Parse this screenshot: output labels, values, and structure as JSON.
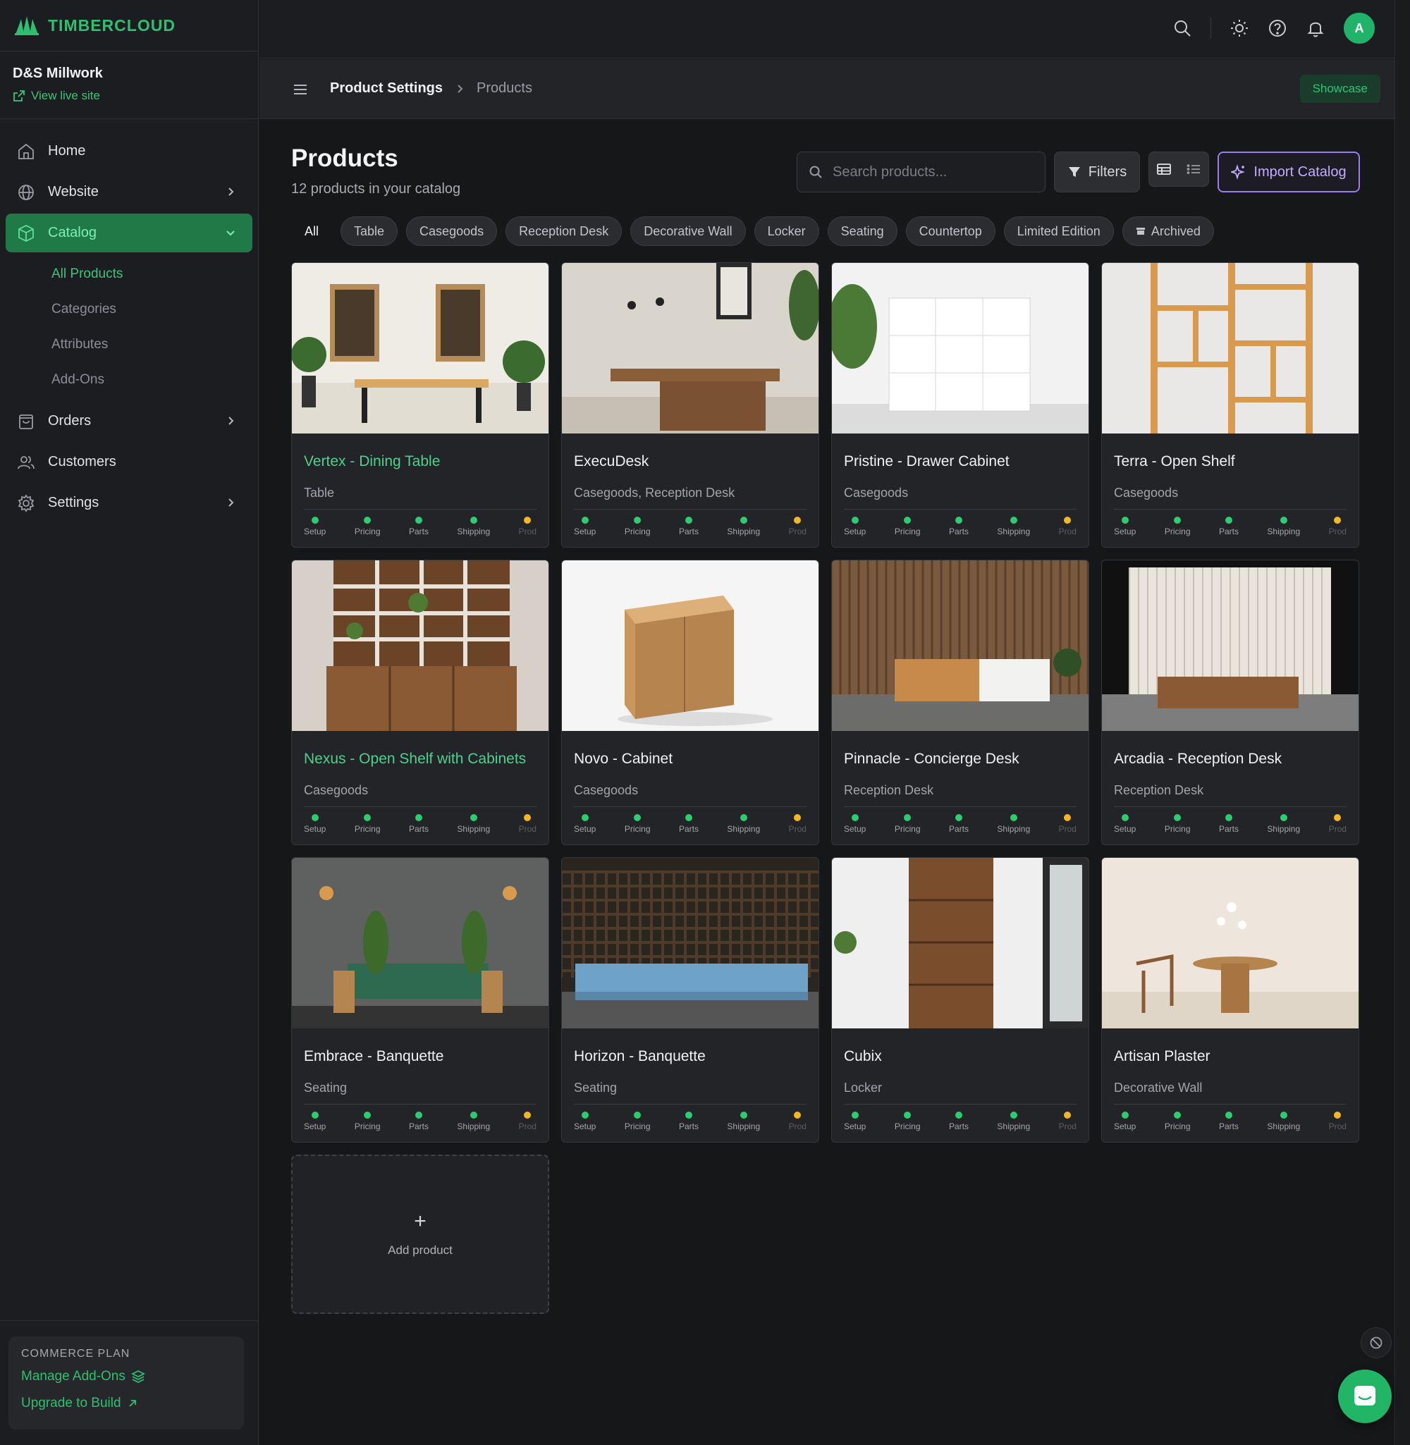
{
  "brand": {
    "name": "TIMBERCLOUD",
    "color": "#2fbf71"
  },
  "org": {
    "name": "D&S Millwork",
    "view_live_site": "View live site"
  },
  "nav": {
    "home": "Home",
    "website": "Website",
    "catalog": "Catalog",
    "catalog_sub": [
      "All Products",
      "Categories",
      "Attributes",
      "Add-Ons"
    ],
    "orders": "Orders",
    "customers": "Customers",
    "settings": "Settings"
  },
  "plan": {
    "title": "COMMERCE PLAN",
    "manage": "Manage Add-Ons",
    "upgrade": "Upgrade to Build"
  },
  "topbar": {
    "avatar_initial": "A"
  },
  "breadcrumb": {
    "parent": "Product Settings",
    "current": "Products",
    "showcase": "Showcase"
  },
  "header": {
    "title": "Products",
    "subtitle": "12 products in your catalog",
    "search_placeholder": "Search products...",
    "filters": "Filters",
    "import": "Import Catalog"
  },
  "chips": [
    "All",
    "Table",
    "Casegoods",
    "Reception Desk",
    "Decorative Wall",
    "Locker",
    "Seating",
    "Countertop",
    "Limited Edition",
    "Archived"
  ],
  "step_labels": [
    "Setup",
    "Pricing",
    "Parts",
    "Shipping",
    "Prod"
  ],
  "products": [
    {
      "title": "Vertex - Dining Table",
      "category": "Table",
      "highlight": true
    },
    {
      "title": "ExecuDesk",
      "category": "Casegoods, Reception Desk"
    },
    {
      "title": "Pristine - Drawer Cabinet",
      "category": "Casegoods"
    },
    {
      "title": "Terra - Open Shelf",
      "category": "Casegoods"
    },
    {
      "title": "Nexus - Open Shelf with Cabinets",
      "category": "Casegoods",
      "highlight": true
    },
    {
      "title": "Novo - Cabinet",
      "category": "Casegoods"
    },
    {
      "title": "Pinnacle - Concierge Desk",
      "category": "Reception Desk"
    },
    {
      "title": "Arcadia - Reception Desk",
      "category": "Reception Desk"
    },
    {
      "title": "Embrace - Banquette",
      "category": "Seating"
    },
    {
      "title": "Horizon - Banquette",
      "category": "Seating"
    },
    {
      "title": "Cubix",
      "category": "Locker"
    },
    {
      "title": "Artisan Plaster",
      "category": "Decorative Wall"
    }
  ],
  "add_product": "Add product",
  "colors": {
    "accent": "#2fbf71",
    "import": "#9b7df0",
    "status_done": "#2ecc71",
    "status_pending": "#f5b623"
  }
}
